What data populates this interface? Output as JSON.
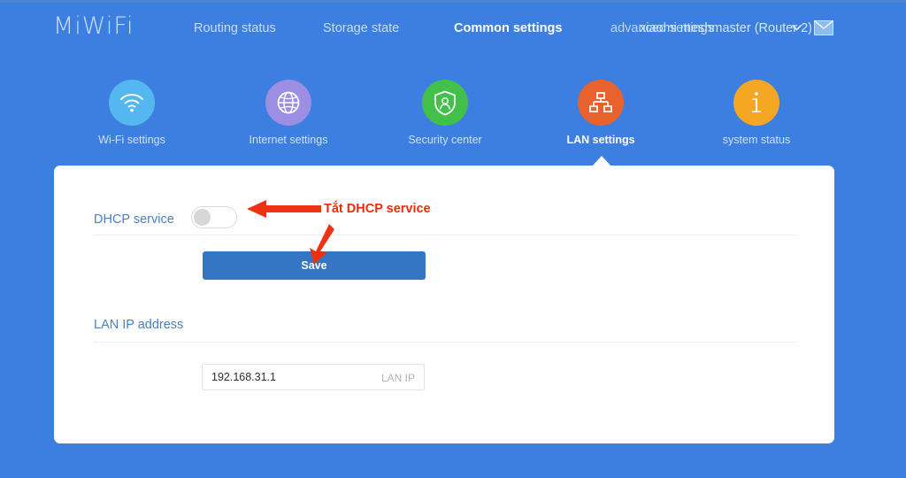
{
  "theme": {
    "page_bg": "#3c7fe0",
    "card_bg": "#ffffff",
    "link_blue": "#4a7fc4",
    "button_blue": "#3576c4",
    "annotation_red": "#ef2a0c"
  },
  "topnav": {
    "brand": "MiWiFi",
    "items": [
      {
        "label": "Routing status",
        "active": false
      },
      {
        "label": "Storage state",
        "active": false
      },
      {
        "label": "Common settings",
        "active": true
      }
    ],
    "advanced_label": "advanced settings",
    "router_label": "xiaomi meshmaster (Router 2)",
    "dropdown_icon": "chevron-down-icon",
    "mail_icon": "mail-icon"
  },
  "categories": [
    {
      "label": "Wi-Fi settings",
      "icon": "wifi-icon",
      "color": "#54b7ef",
      "active": false
    },
    {
      "label": "Internet settings",
      "icon": "globe-icon",
      "color": "#9c8ee3",
      "active": false
    },
    {
      "label": "Security center",
      "icon": "shield-icon",
      "color": "#43c04a",
      "active": false
    },
    {
      "label": "LAN settings",
      "icon": "network-icon",
      "color": "#e8622e",
      "active": true
    },
    {
      "label": "system status",
      "icon": "info-icon",
      "color": "#f5a623",
      "active": false
    }
  ],
  "panel": {
    "dhcp_label": "DHCP service",
    "dhcp_enabled": false,
    "save_label": "Save",
    "lan_section_title": "LAN IP address",
    "lan_ip_value": "192.168.31.1",
    "lan_ip_suffix": "LAN IP",
    "lan_ip_placeholder": "192.168.31.1"
  },
  "annotations": {
    "dhcp_note": "Tắt DHCP service"
  }
}
